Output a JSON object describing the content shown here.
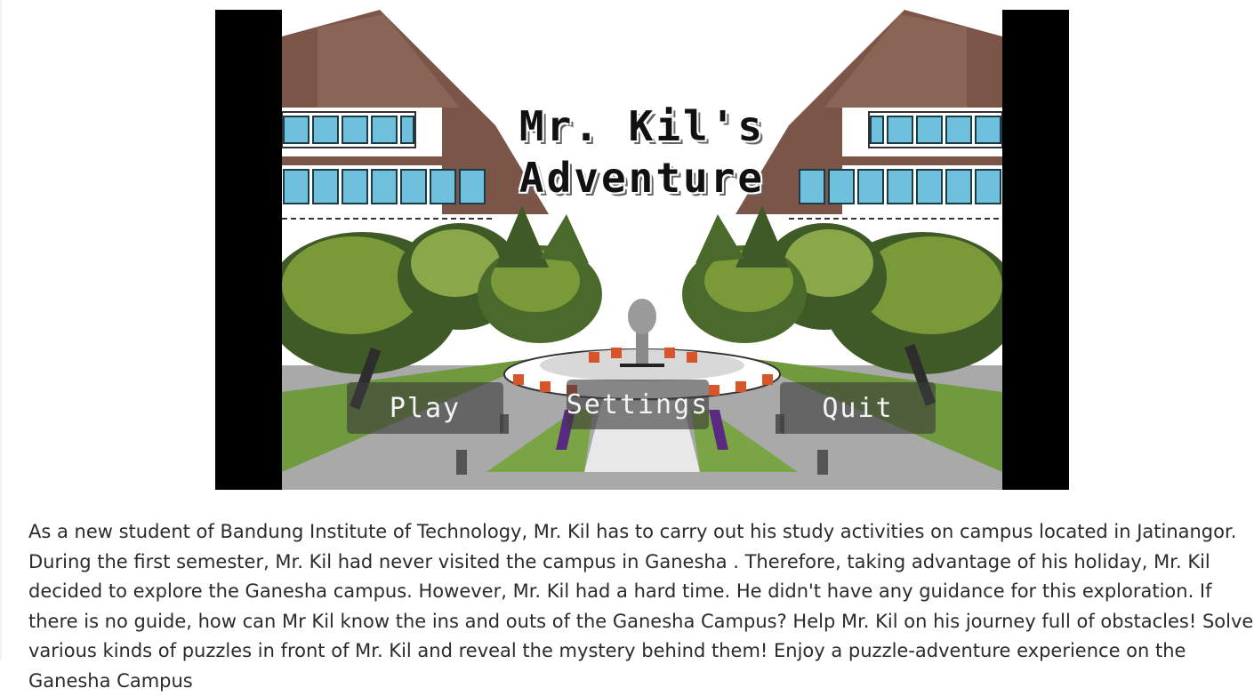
{
  "game": {
    "title_line1": "Mr. Kil's",
    "title_line2": "Adventure",
    "menu": {
      "play_label": "Play",
      "settings_label": "Settings",
      "quit_label": "Quit"
    }
  },
  "description": "As a new student of Bandung Institute of Technology, Mr. Kil has to carry out his study activities on campus located in Jatinangor. During the first semester, Mr. Kil had never visited the campus in Ganesha . Therefore, taking advantage of his holiday, Mr. Kil decided to explore the Ganesha campus. However, Mr. Kil had a hard time. He didn't have any guidance for this exploration. If there is no guide, how can Mr Kil know the ins and outs of the Ganesha Campus? Help Mr. Kil on his journey full of obstacles! Solve various kinds of puzzles in front of Mr. Kil and reveal the mystery behind them! Enjoy a puzzle-adventure experience on the Ganesha Campus",
  "colors": {
    "roof": "#7a5548",
    "window": "#6fc0dc",
    "tree_dark": "#3f5a26",
    "tree_light": "#7a9a3a",
    "grass": "#6f9a3e",
    "path": "#b8b8b8",
    "flower_red": "#d8552a",
    "statue": "#9a9a9a",
    "purple": "#5a2a82"
  }
}
